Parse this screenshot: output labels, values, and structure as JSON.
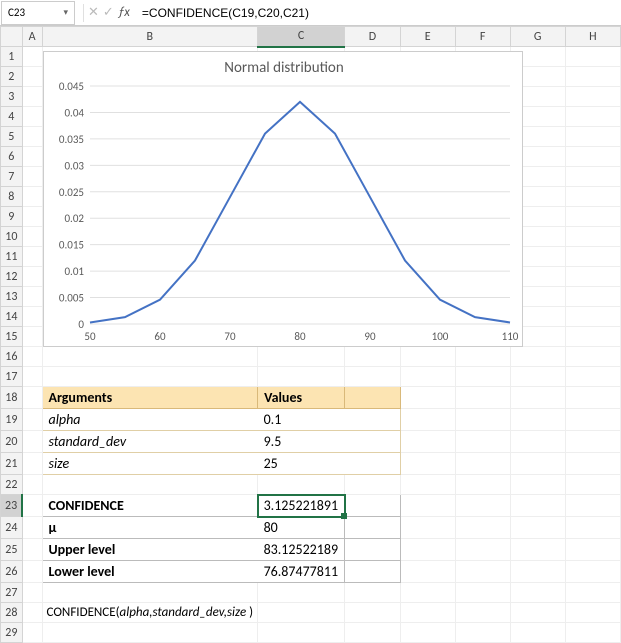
{
  "formula_bar": {
    "name_box": "C23",
    "formula": "=CONFIDENCE(C19,C20,C21)"
  },
  "columns": [
    "A",
    "B",
    "C",
    "D",
    "E",
    "F",
    "G",
    "H"
  ],
  "rows": [
    "1",
    "2",
    "3",
    "4",
    "5",
    "6",
    "7",
    "8",
    "9",
    "10",
    "11",
    "12",
    "13",
    "14",
    "15",
    "16",
    "17",
    "18",
    "19",
    "20",
    "21",
    "22",
    "23",
    "24",
    "25",
    "26",
    "27",
    "28",
    "29"
  ],
  "selected_col": "C",
  "selected_row": "23",
  "args_table": {
    "hdr_name": "Arguments",
    "hdr_val": "Values",
    "rows": [
      {
        "name": "alpha",
        "value": "0.1"
      },
      {
        "name": "standard_dev",
        "value": "9.5"
      },
      {
        "name": "size",
        "value": "25"
      }
    ]
  },
  "results_table": {
    "rows": [
      {
        "name": "CONFIDENCE",
        "value": "3.125221891",
        "selected": true
      },
      {
        "name": "μ",
        "value": "80"
      },
      {
        "name": "Upper level",
        "value": "83.12522189"
      },
      {
        "name": "Lower level",
        "value": "76.87477811"
      }
    ]
  },
  "syntax_line": {
    "func": "CONFIDENCE(",
    "args": "alpha,standard_dev,size",
    "close": " )"
  },
  "chart_data": {
    "type": "line",
    "title": "Normal distribution",
    "xlabel": "",
    "ylabel": "",
    "xlim": [
      50,
      110
    ],
    "ylim": [
      0,
      0.045
    ],
    "xticks": [
      50,
      60,
      70,
      80,
      90,
      100,
      110
    ],
    "yticks": [
      0,
      0.005,
      0.01,
      0.015,
      0.02,
      0.025,
      0.03,
      0.035,
      0.04,
      0.045
    ],
    "x": [
      50,
      55,
      60,
      65,
      70,
      75,
      80,
      85,
      90,
      95,
      100,
      105,
      110
    ],
    "values": [
      0.00029,
      0.0013,
      0.0046,
      0.012,
      0.024,
      0.036,
      0.042,
      0.036,
      0.024,
      0.012,
      0.0046,
      0.0013,
      0.00029
    ]
  }
}
